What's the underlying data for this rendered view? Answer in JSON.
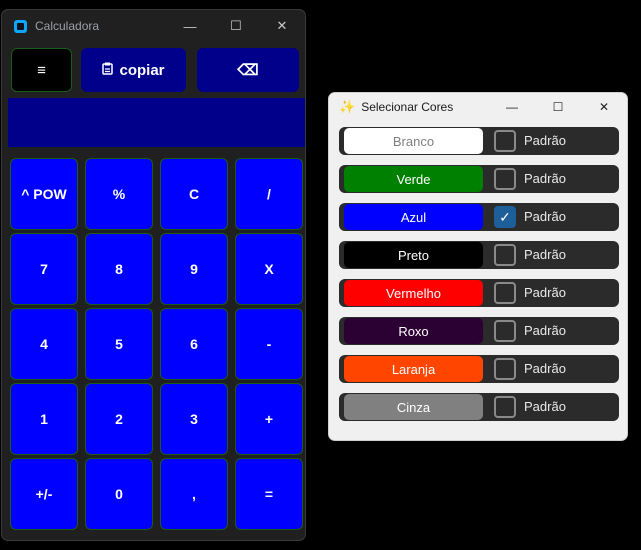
{
  "calculator": {
    "title": "Calculadora",
    "menu_label": "≡",
    "copy_label": "copiar",
    "copy_icon": "clipboard-icon",
    "backspace_label": "⌫",
    "display_value": "",
    "keys": [
      "^ POW",
      "%",
      "C",
      "/",
      "7",
      "8",
      "9",
      "X",
      "4",
      "5",
      "6",
      "-",
      "1",
      "2",
      "3",
      "+",
      "+/-",
      "0",
      ",",
      "="
    ],
    "colors": {
      "menu_bg": "#000000",
      "button_bg": "#00008b",
      "display_bg": "#00008b",
      "key_bg": "#0000ff"
    }
  },
  "color_picker": {
    "title": "Selecionar Cores",
    "default_label": "Padrão",
    "items": [
      {
        "label": "Branco",
        "color": "#ffffff",
        "text_color": "#808080",
        "checked": false
      },
      {
        "label": "Verde",
        "color": "#008000",
        "text_color": "#ffffff",
        "checked": false
      },
      {
        "label": "Azul",
        "color": "#0000ff",
        "text_color": "#ffffff",
        "checked": true
      },
      {
        "label": "Preto",
        "color": "#000000",
        "text_color": "#ffffff",
        "checked": false
      },
      {
        "label": "Vermelho",
        "color": "#ff0000",
        "text_color": "#ffffff",
        "checked": false
      },
      {
        "label": "Roxo",
        "color": "#2b0033",
        "text_color": "#ffffff",
        "checked": false
      },
      {
        "label": "Laranja",
        "color": "#ff4500",
        "text_color": "#ffffff",
        "checked": false
      },
      {
        "label": "Cinza",
        "color": "#808080",
        "text_color": "#ffffff",
        "checked": false
      }
    ]
  }
}
